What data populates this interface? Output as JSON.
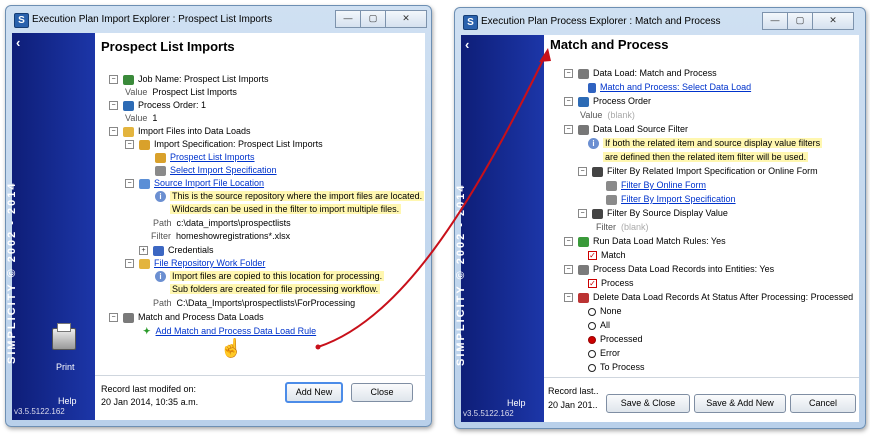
{
  "left_window": {
    "title": "Execution Plan Import Explorer : Prospect List Imports",
    "controls": [
      "—",
      "▢",
      "✕"
    ],
    "sidebar": {
      "brand": "SIMPLICITY © 2002 - 2014",
      "print_label": "Print",
      "help_label": "Help",
      "version": "v3.5.5122.162"
    },
    "page_title": "Prospect List Imports",
    "rows": {
      "job_name": "Job Name:  Prospect List Imports",
      "job_value_label": "Value",
      "job_value": "Prospect List Imports",
      "process_order": "Process Order:  1",
      "order_value_label": "Value",
      "order_value": "1",
      "import_files": "Import Files into Data Loads",
      "import_spec": "Import Specification:  Prospect List Imports",
      "prospect_link": "Prospect List Imports",
      "select_spec_link": "Select Import Specification",
      "source_location_link": "Source Import File Location",
      "source_note_1": "This is the source repository where the import files are located.",
      "source_note_2": "Wildcards can be used in the filter to import multiple files.",
      "path_label": "Path",
      "path_value": "c:\\data_imports\\prospectlists",
      "filter_label": "Filter",
      "filter_value": "homeshowregistrations*.xlsx",
      "credentials": "Credentials",
      "repo_folder_link": "File Repository Work Folder",
      "repo_note_1": "Import files are copied to this location for processing.",
      "repo_note_2": "Sub folders are created for file processing workflow.",
      "repo_path_label": "Path",
      "repo_path_value": "C:\\Data_Imports\\prospectlists\\ForProcessing",
      "match_loads": "Match and Process Data Loads",
      "add_rule_link": "Add Match and Process Data Load Rule"
    },
    "footer": {
      "record_label": "Record last modifed on:",
      "record_date": "20 Jan 2014, 10:35 a.m.",
      "add_new": "Add New",
      "close": "Close"
    }
  },
  "right_window": {
    "title": "Execution Plan Process Explorer : Match and Process",
    "controls": [
      "—",
      "▢",
      "✕"
    ],
    "sidebar": {
      "brand": "SIMPLICITY © 2002 - 2014",
      "help_label": "Help",
      "version": "v3.5.5122.162"
    },
    "page_title": "Match and Process",
    "rows": {
      "data_load": "Data Load:  Match and Process",
      "select_load_link": "Match and Process:  Select Data Load",
      "process_order": "Process Order",
      "value_label": "Value",
      "value_blank": "(blank)",
      "source_filter": "Data Load Source Filter",
      "filter_note_1": "If both the related item and source display value filters",
      "filter_note_2": "are defined then the related item filter will be used.",
      "filter_related": "Filter By Related Import Specification or Online Form",
      "online_form_link": "Filter By Online Form",
      "import_spec_link": "Filter By Import Specification",
      "filter_source": "Filter By Source Display Value",
      "filter_label": "Filter",
      "filter_blank": "(blank)",
      "run_rules": "Run Data Load Match Rules:  Yes",
      "match": "Match",
      "process_records": "Process Data Load Records into Entities:  Yes",
      "process": "Process",
      "delete_records": "Delete Data Load Records At Status After Processing:  Processed",
      "opt_none": "None",
      "opt_all": "All",
      "opt_processed": "Processed",
      "opt_error": "Error",
      "opt_to_process": "To Process"
    },
    "footer": {
      "record_label": "Record last..",
      "record_date": "20 Jan 201..",
      "save_close": "Save & Close",
      "save_add_new": "Save & Add New",
      "cancel": "Cancel"
    }
  },
  "colors": {
    "sidebar": "#1c36a8",
    "link": "#0033cc",
    "note": "#fff7b0",
    "arrow": "#c8101a"
  }
}
